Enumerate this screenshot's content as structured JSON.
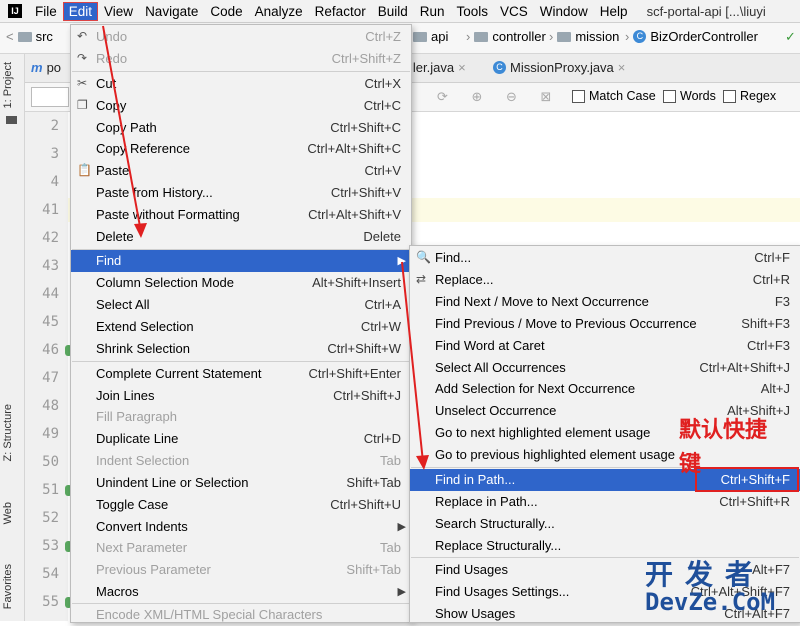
{
  "menubar": {
    "items": [
      "File",
      "Edit",
      "View",
      "Navigate",
      "Code",
      "Analyze",
      "Refactor",
      "Build",
      "Run",
      "Tools",
      "VCS",
      "Window",
      "Help"
    ],
    "project_title": "scf-portal-api [...\\liuyi"
  },
  "navbar": {
    "left_crumb": "src",
    "crumbs": [
      "api",
      "controller",
      "mission",
      "BizOrderController"
    ]
  },
  "left_strip": {
    "project": "1: Project",
    "structure": "Z: Structure",
    "web": "Web",
    "favorites": "Favorites"
  },
  "tabs": {
    "first": "po",
    "second": "ller.java",
    "third": "MissionProxy.java"
  },
  "search": {
    "match_case": "Match Case",
    "words": "Words",
    "regex": "Regex"
  },
  "line_numbers": [
    "2",
    "3",
    "4",
    "41",
    "42",
    "43",
    "44",
    "45",
    "46",
    "47",
    "48",
    "49",
    "50",
    "51",
    "52",
    "53",
    "54",
    "55"
  ],
  "edit_menu": {
    "items": [
      {
        "label": "Undo",
        "shortcut": "Ctrl+Z",
        "disabled": true
      },
      {
        "label": "Redo",
        "shortcut": "Ctrl+Shift+Z",
        "disabled": true
      },
      {
        "label": "Cut",
        "shortcut": "Ctrl+X"
      },
      {
        "label": "Copy",
        "shortcut": "Ctrl+C"
      },
      {
        "label": "Copy Path",
        "shortcut": "Ctrl+Shift+C"
      },
      {
        "label": "Copy Reference",
        "shortcut": "Ctrl+Alt+Shift+C"
      },
      {
        "label": "Paste",
        "shortcut": "Ctrl+V"
      },
      {
        "label": "Paste from History...",
        "shortcut": "Ctrl+Shift+V"
      },
      {
        "label": "Paste without Formatting",
        "shortcut": "Ctrl+Alt+Shift+V"
      },
      {
        "label": "Delete",
        "shortcut": "Delete"
      },
      {
        "label": "Find",
        "shortcut": ""
      },
      {
        "label": "Column Selection Mode",
        "shortcut": "Alt+Shift+Insert"
      },
      {
        "label": "Select All",
        "shortcut": "Ctrl+A"
      },
      {
        "label": "Extend Selection",
        "shortcut": "Ctrl+W"
      },
      {
        "label": "Shrink Selection",
        "shortcut": "Ctrl+Shift+W"
      },
      {
        "label": "Complete Current Statement",
        "shortcut": "Ctrl+Shift+Enter"
      },
      {
        "label": "Join Lines",
        "shortcut": "Ctrl+Shift+J"
      },
      {
        "label": "Fill Paragraph",
        "shortcut": "",
        "disabled": true
      },
      {
        "label": "Duplicate Line",
        "shortcut": "Ctrl+D"
      },
      {
        "label": "Indent Selection",
        "shortcut": "Tab",
        "disabled": true
      },
      {
        "label": "Unindent Line or Selection",
        "shortcut": "Shift+Tab"
      },
      {
        "label": "Toggle Case",
        "shortcut": "Ctrl+Shift+U"
      },
      {
        "label": "Convert Indents",
        "shortcut": ""
      },
      {
        "label": "Next Parameter",
        "shortcut": "Tab",
        "disabled": true
      },
      {
        "label": "Previous Parameter",
        "shortcut": "Shift+Tab",
        "disabled": true
      },
      {
        "label": "Macros",
        "shortcut": ""
      },
      {
        "label": "Encode XML/HTML Special Characters",
        "shortcut": "",
        "disabled": true
      }
    ]
  },
  "find_menu": {
    "items": [
      {
        "label": "Find...",
        "shortcut": "Ctrl+F"
      },
      {
        "label": "Replace...",
        "shortcut": "Ctrl+R"
      },
      {
        "label": "Find Next / Move to Next Occurrence",
        "shortcut": "F3"
      },
      {
        "label": "Find Previous / Move to Previous Occurrence",
        "shortcut": "Shift+F3"
      },
      {
        "label": "Find Word at Caret",
        "shortcut": "Ctrl+F3"
      },
      {
        "label": "Select All Occurrences",
        "shortcut": "Ctrl+Alt+Shift+J"
      },
      {
        "label": "Add Selection for Next Occurrence",
        "shortcut": "Alt+J"
      },
      {
        "label": "Unselect Occurrence",
        "shortcut": "Alt+Shift+J"
      },
      {
        "label": "Go to next highlighted element usage",
        "shortcut": ""
      },
      {
        "label": "Go to previous highlighted element usage",
        "shortcut": ""
      },
      {
        "label": "Find in Path...",
        "shortcut": "Ctrl+Shift+F"
      },
      {
        "label": "Replace in Path...",
        "shortcut": "Ctrl+Shift+R"
      },
      {
        "label": "Search Structurally...",
        "shortcut": ""
      },
      {
        "label": "Replace Structurally...",
        "shortcut": ""
      },
      {
        "label": "Find Usages",
        "shortcut": "Alt+F7"
      },
      {
        "label": "Find Usages Settings...",
        "shortcut": "Ctrl+Alt+Shift+F7"
      },
      {
        "label": "Show Usages",
        "shortcut": "Ctrl+Alt+F7"
      }
    ]
  },
  "annotation": {
    "line1": "默认快捷",
    "line2": "键"
  },
  "watermark": {
    "cn": "开发者",
    "en": "DevZe.CoM"
  },
  "colors": {
    "highlight": "#2f65ca",
    "annotation_red": "#e02020",
    "watermark_blue": "#1f4f9a"
  }
}
